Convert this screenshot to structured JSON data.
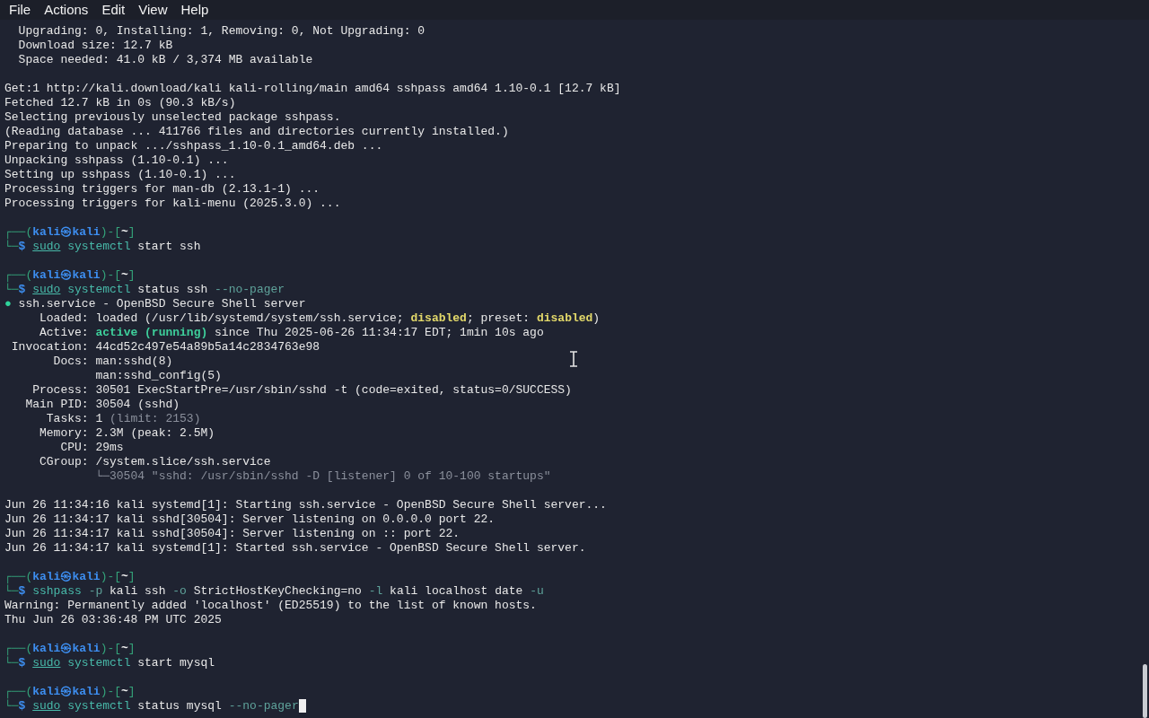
{
  "menu": [
    {
      "label": "File"
    },
    {
      "label": "Actions"
    },
    {
      "label": "Edit"
    },
    {
      "label": "View"
    },
    {
      "label": "Help"
    }
  ],
  "terminal": {
    "cursor_visible": true,
    "lines": [
      {
        "kind": "text",
        "segments": [
          {
            "text": "  Upgrading: 0, Installing: 1, Removing: 0, Not Upgrading: 0",
            "kind": "plain"
          }
        ]
      },
      {
        "kind": "text",
        "segments": [
          {
            "text": "  Download size: 12.7 kB",
            "kind": "plain"
          }
        ]
      },
      {
        "kind": "text",
        "segments": [
          {
            "text": "  Space needed: 41.0 kB / 3,374 MB available",
            "kind": "plain"
          }
        ]
      },
      {
        "kind": "blank"
      },
      {
        "kind": "text",
        "segments": [
          {
            "text": "Get:1 http://kali.download/kali kali-rolling/main amd64 sshpass amd64 1.10-0.1 [12.7 kB]",
            "kind": "plain"
          }
        ]
      },
      {
        "kind": "text",
        "segments": [
          {
            "text": "Fetched 12.7 kB in 0s (90.3 kB/s)",
            "kind": "plain"
          }
        ]
      },
      {
        "kind": "text",
        "segments": [
          {
            "text": "Selecting previously unselected package sshpass.",
            "kind": "plain"
          }
        ]
      },
      {
        "kind": "text",
        "segments": [
          {
            "text": "(Reading database ... 411766 files and directories currently installed.)",
            "kind": "plain"
          }
        ]
      },
      {
        "kind": "text",
        "segments": [
          {
            "text": "Preparing to unpack .../sshpass_1.10-0.1_amd64.deb ...",
            "kind": "plain"
          }
        ]
      },
      {
        "kind": "text",
        "segments": [
          {
            "text": "Unpacking sshpass (1.10-0.1) ...",
            "kind": "plain"
          }
        ]
      },
      {
        "kind": "text",
        "segments": [
          {
            "text": "Setting up sshpass (1.10-0.1) ...",
            "kind": "plain"
          }
        ]
      },
      {
        "kind": "text",
        "segments": [
          {
            "text": "Processing triggers for man-db (2.13.1-1) ...",
            "kind": "plain"
          }
        ]
      },
      {
        "kind": "text",
        "segments": [
          {
            "text": "Processing triggers for kali-menu (2025.3.0) ...",
            "kind": "plain"
          }
        ]
      },
      {
        "kind": "blank"
      },
      {
        "kind": "text",
        "segments": [
          {
            "text": "┌──(",
            "kind": "frame"
          },
          {
            "text": "kali㉿kali",
            "kind": "user"
          },
          {
            "text": ")-[",
            "kind": "frame"
          },
          {
            "text": "~",
            "kind": "dir"
          },
          {
            "text": "]",
            "kind": "frame"
          }
        ]
      },
      {
        "kind": "text",
        "segments": [
          {
            "text": "└─",
            "kind": "frame"
          },
          {
            "text": "$ ",
            "kind": "user"
          },
          {
            "text": "sudo",
            "kind": "command_underlined"
          },
          {
            "text": " systemctl",
            "kind": "command"
          },
          {
            "text": " start ssh",
            "kind": "plain"
          }
        ]
      },
      {
        "kind": "blank"
      },
      {
        "kind": "text",
        "segments": [
          {
            "text": "┌──(",
            "kind": "frame"
          },
          {
            "text": "kali㉿kali",
            "kind": "user"
          },
          {
            "text": ")-[",
            "kind": "frame"
          },
          {
            "text": "~",
            "kind": "dir"
          },
          {
            "text": "]",
            "kind": "frame"
          }
        ]
      },
      {
        "kind": "text",
        "segments": [
          {
            "text": "└─",
            "kind": "frame"
          },
          {
            "text": "$ ",
            "kind": "user"
          },
          {
            "text": "sudo",
            "kind": "command_underlined"
          },
          {
            "text": " systemctl",
            "kind": "command"
          },
          {
            "text": " status ssh ",
            "kind": "plain"
          },
          {
            "text": "--no-pager",
            "kind": "option"
          }
        ]
      },
      {
        "kind": "text",
        "segments": [
          {
            "text": "●",
            "kind": "bullet"
          },
          {
            "text": " ssh.service - OpenBSD Secure Shell server",
            "kind": "plain"
          }
        ]
      },
      {
        "kind": "text",
        "segments": [
          {
            "text": "     Loaded: loaded (/usr/lib/systemd/system/ssh.service; ",
            "kind": "plain"
          },
          {
            "text": "disabled",
            "kind": "warning"
          },
          {
            "text": "; preset: ",
            "kind": "plain"
          },
          {
            "text": "disabled",
            "kind": "warning"
          },
          {
            "text": ")",
            "kind": "plain"
          }
        ]
      },
      {
        "kind": "text",
        "segments": [
          {
            "text": "     Active: ",
            "kind": "plain"
          },
          {
            "text": "active (running)",
            "kind": "active"
          },
          {
            "text": " since Thu 2025-06-26 11:34:17 EDT; 1min 10s ago",
            "kind": "plain"
          }
        ]
      },
      {
        "kind": "text",
        "segments": [
          {
            "text": " Invocation: 44cd52c497e54a89b5a14c2834763e98",
            "kind": "plain"
          }
        ]
      },
      {
        "kind": "text",
        "segments": [
          {
            "text": "       Docs: man:sshd(8)",
            "kind": "plain"
          }
        ]
      },
      {
        "kind": "text",
        "segments": [
          {
            "text": "             man:sshd_config(5)",
            "kind": "plain"
          }
        ]
      },
      {
        "kind": "text",
        "segments": [
          {
            "text": "    Process: 30501 ExecStartPre=/usr/sbin/sshd -t (code=exited, status=0/SUCCESS)",
            "kind": "plain"
          }
        ]
      },
      {
        "kind": "text",
        "segments": [
          {
            "text": "   Main PID: 30504 (sshd)",
            "kind": "plain"
          }
        ]
      },
      {
        "kind": "text",
        "segments": [
          {
            "text": "      Tasks: 1 ",
            "kind": "plain"
          },
          {
            "text": "(limit: 2153)",
            "kind": "muted"
          }
        ]
      },
      {
        "kind": "text",
        "segments": [
          {
            "text": "     Memory: 2.3M (peak: 2.5M)",
            "kind": "plain"
          }
        ]
      },
      {
        "kind": "text",
        "segments": [
          {
            "text": "        CPU: 29ms",
            "kind": "plain"
          }
        ]
      },
      {
        "kind": "text",
        "segments": [
          {
            "text": "     CGroup: /system.slice/ssh.service",
            "kind": "plain"
          }
        ]
      },
      {
        "kind": "text",
        "segments": [
          {
            "text": "             └─30504 \"sshd: /usr/sbin/sshd -D [listener] 0 of 10-100 startups\"",
            "kind": "muted"
          }
        ]
      },
      {
        "kind": "blank"
      },
      {
        "kind": "text",
        "segments": [
          {
            "text": "Jun 26 11:34:16 kali systemd[1]: Starting ssh.service - OpenBSD Secure Shell server...",
            "kind": "plain"
          }
        ]
      },
      {
        "kind": "text",
        "segments": [
          {
            "text": "Jun 26 11:34:17 kali sshd[30504]: Server listening on 0.0.0.0 port 22.",
            "kind": "plain"
          }
        ]
      },
      {
        "kind": "text",
        "segments": [
          {
            "text": "Jun 26 11:34:17 kali sshd[30504]: Server listening on :: port 22.",
            "kind": "plain"
          }
        ]
      },
      {
        "kind": "text",
        "segments": [
          {
            "text": "Jun 26 11:34:17 kali systemd[1]: Started ssh.service - OpenBSD Secure Shell server.",
            "kind": "plain"
          }
        ]
      },
      {
        "kind": "blank"
      },
      {
        "kind": "text",
        "segments": [
          {
            "text": "┌──(",
            "kind": "frame"
          },
          {
            "text": "kali㉿kali",
            "kind": "user"
          },
          {
            "text": ")-[",
            "kind": "frame"
          },
          {
            "text": "~",
            "kind": "dir"
          },
          {
            "text": "]",
            "kind": "frame"
          }
        ]
      },
      {
        "kind": "text",
        "segments": [
          {
            "text": "└─",
            "kind": "frame"
          },
          {
            "text": "$ ",
            "kind": "user"
          },
          {
            "text": "sshpass",
            "kind": "command"
          },
          {
            "text": " -p",
            "kind": "option"
          },
          {
            "text": " kali ssh ",
            "kind": "plain"
          },
          {
            "text": "-o",
            "kind": "option"
          },
          {
            "text": " StrictHostKeyChecking=no ",
            "kind": "plain"
          },
          {
            "text": "-l",
            "kind": "option"
          },
          {
            "text": " kali localhost date ",
            "kind": "plain"
          },
          {
            "text": "-u",
            "kind": "option"
          }
        ]
      },
      {
        "kind": "text",
        "segments": [
          {
            "text": "Warning: Permanently added 'localhost' (ED25519) to the list of known hosts.",
            "kind": "plain"
          }
        ]
      },
      {
        "kind": "text",
        "segments": [
          {
            "text": "Thu Jun 26 03:36:48 PM UTC 2025",
            "kind": "plain"
          }
        ]
      },
      {
        "kind": "blank"
      },
      {
        "kind": "text",
        "segments": [
          {
            "text": "┌──(",
            "kind": "frame"
          },
          {
            "text": "kali㉿kali",
            "kind": "user"
          },
          {
            "text": ")-[",
            "kind": "frame"
          },
          {
            "text": "~",
            "kind": "dir"
          },
          {
            "text": "]",
            "kind": "frame"
          }
        ]
      },
      {
        "kind": "text",
        "segments": [
          {
            "text": "└─",
            "kind": "frame"
          },
          {
            "text": "$ ",
            "kind": "user"
          },
          {
            "text": "sudo",
            "kind": "command_underlined"
          },
          {
            "text": " systemctl",
            "kind": "command"
          },
          {
            "text": " start mysql",
            "kind": "plain"
          }
        ]
      },
      {
        "kind": "blank"
      },
      {
        "kind": "text",
        "segments": [
          {
            "text": "┌──(",
            "kind": "frame"
          },
          {
            "text": "kali㉿kali",
            "kind": "user"
          },
          {
            "text": ")-[",
            "kind": "frame"
          },
          {
            "text": "~",
            "kind": "dir"
          },
          {
            "text": "]",
            "kind": "frame"
          }
        ]
      },
      {
        "kind": "text",
        "segments": [
          {
            "text": "└─",
            "kind": "frame"
          },
          {
            "text": "$ ",
            "kind": "user"
          },
          {
            "text": "sudo",
            "kind": "command_underlined"
          },
          {
            "text": " systemctl",
            "kind": "command"
          },
          {
            "text": " status mysql ",
            "kind": "plain"
          },
          {
            "text": "--no-pager",
            "kind": "option"
          }
        ]
      }
    ]
  }
}
